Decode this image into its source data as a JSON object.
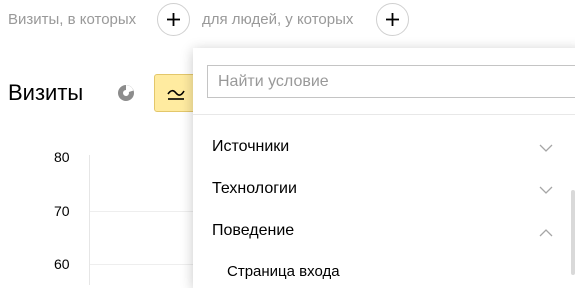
{
  "filters": {
    "visits_label": "Визиты, в которых",
    "people_label": "для людей, у которых"
  },
  "report": {
    "title": "Визиты"
  },
  "chart": {
    "y_ticks": [
      "80",
      "70",
      "60"
    ]
  },
  "dropdown": {
    "search_placeholder": "Найти условие",
    "categories": [
      {
        "label": "Источники",
        "state": "collapsed"
      },
      {
        "label": "Технологии",
        "state": "collapsed"
      },
      {
        "label": "Поведение",
        "state": "expanded"
      }
    ],
    "sub_items": [
      "Страница входа"
    ]
  },
  "colors": {
    "accent_button": "#ffeba0",
    "muted_text": "#999999"
  },
  "icons": {
    "add": "plus-icon",
    "pie": "pie-chart-icon",
    "line": "line-chart-icon",
    "collapsed": "chevron-down-icon",
    "expanded": "chevron-up-icon"
  }
}
